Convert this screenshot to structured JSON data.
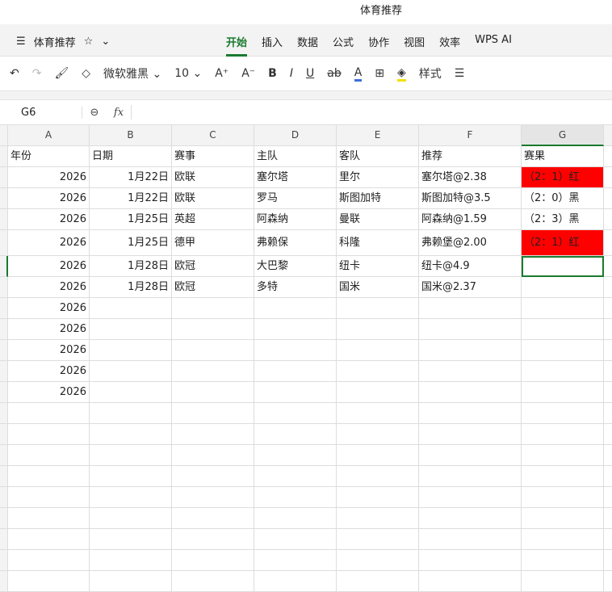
{
  "title": "体育推荐",
  "menu": {
    "doc_name": "体育推荐",
    "tabs": [
      "开始",
      "插入",
      "数据",
      "公式",
      "协作",
      "视图",
      "效率",
      "WPS AI"
    ]
  },
  "toolbar": {
    "font": "微软雅黑",
    "size": "10",
    "style_label": "样式"
  },
  "formula_bar": {
    "cell_ref": "G6",
    "fx": "fx",
    "value": ""
  },
  "columns": [
    "A",
    "B",
    "C",
    "D",
    "E",
    "F",
    "G"
  ],
  "selected_column": "G",
  "rows": [
    [
      "年份",
      "日期",
      "赛事",
      "主队",
      "客队",
      "推荐",
      "赛果"
    ],
    [
      "2026",
      "1月22日",
      "欧联",
      "塞尔塔",
      "里尔",
      "塞尔塔@2.38",
      "（2：1）红"
    ],
    [
      "2026",
      "1月22日",
      "欧联",
      "罗马",
      "斯图加特",
      "斯图加特@3.5",
      "（2：0）黑"
    ],
    [
      "2026",
      "1月25日",
      "英超",
      "阿森纳",
      "曼联",
      "阿森纳@1.59",
      "（2：3）黑"
    ],
    [
      "2026",
      "1月25日",
      "德甲",
      "弗赖保",
      "科隆",
      "弗赖堡@2.00",
      "（2：1）红"
    ],
    [
      "2026",
      "1月28日",
      "欧冠",
      "大巴黎",
      "纽卡",
      "纽卡@4.9",
      ""
    ],
    [
      "2026",
      "1月28日",
      "欧冠",
      "多特",
      "国米",
      "国米@2.37",
      ""
    ],
    [
      "2026",
      "",
      "",
      "",
      "",
      "",
      ""
    ],
    [
      "2026",
      "",
      "",
      "",
      "",
      "",
      ""
    ],
    [
      "2026",
      "",
      "",
      "",
      "",
      "",
      ""
    ],
    [
      "2026",
      "",
      "",
      "",
      "",
      "",
      ""
    ],
    [
      "2026",
      "",
      "",
      "",
      "",
      "",
      ""
    ]
  ],
  "highlight_color": "#ff0000",
  "accent": "#1a7a2e"
}
